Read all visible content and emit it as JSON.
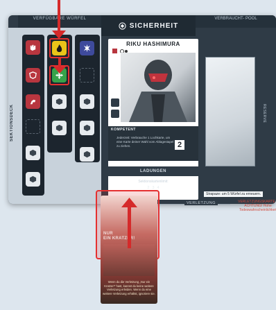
{
  "header": {
    "left": "VERFÜGBARE WÜRFEL",
    "center": "SICHERHEIT",
    "right": "VERBRAUCHT- POOL"
  },
  "left_column_label": "SEKTIONSDECK",
  "character": {
    "name": "RIKU HASHIMURA"
  },
  "kompetenz": {
    "title": "KOMPETENT",
    "text": "Jederzeit: Verbrauche 1 Lochkarte, um eine Karte deiner Wahl vom Ablagestapel zu ziehen.",
    "value": "2"
  },
  "ladungen_label": "LADUNGEN",
  "sektionskarten": {
    "label": "Sektionskartenlimit:",
    "items": [
      "2",
      "3",
      "4"
    ]
  },
  "right_column_label": "RESERVE",
  "strapaze": "Strapaze: um 5 Würfel zu erneuern.",
  "verletzung_label": "VERLETZUNG",
  "verletzung_karte": "VERLETZUNGSKARTE – ACHTUNG! Hohe Todeswahrscheinlichkeit",
  "injury_card": {
    "title": "NUR\nEIN KRATZER!",
    "text": "Wenn du die Verletzung „Nur ein Kratzer!“ hast, kannst du keine weitere Verletzung erleiden. Wenn du eine weitere Verletzung erhältst, ignoriere sie."
  },
  "colors": {
    "highlight": "#e53030",
    "dice_red": "#b8363f",
    "dice_yellow": "#e9c419",
    "dice_green": "#37a34a",
    "dice_blue": "#3e4a9c"
  }
}
